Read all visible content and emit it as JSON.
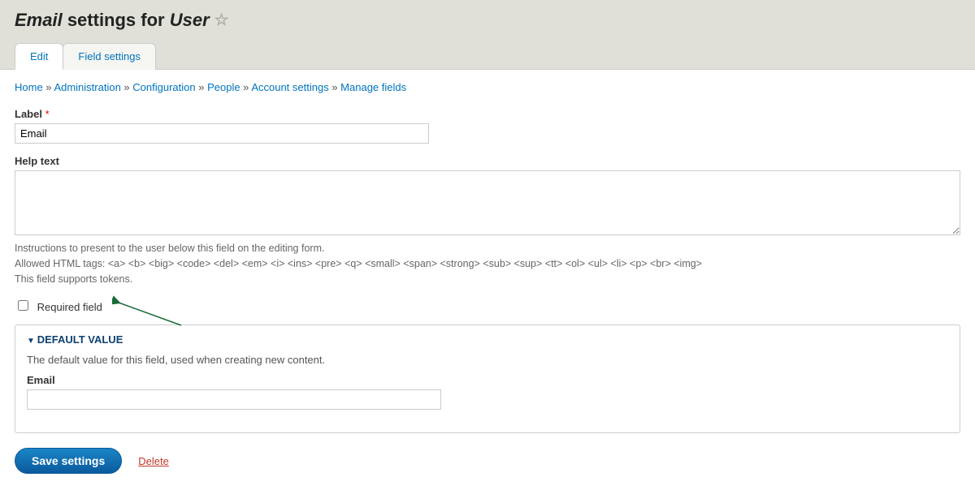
{
  "page": {
    "title_prefix": "Email",
    "title_mid": " settings for ",
    "title_suffix": "User"
  },
  "tabs": [
    {
      "label": "Edit",
      "active": true
    },
    {
      "label": "Field settings",
      "active": false
    }
  ],
  "breadcrumb": {
    "items": [
      "Home",
      "Administration",
      "Configuration",
      "People",
      "Account settings",
      "Manage fields"
    ],
    "sep": " » "
  },
  "form": {
    "label_field": {
      "label": "Label",
      "required_mark": "*",
      "value": "Email"
    },
    "help_text": {
      "label": "Help text",
      "value": "",
      "desc_line1": "Instructions to present to the user below this field on the editing form.",
      "desc_line2": "Allowed HTML tags: <a> <b> <big> <code> <del> <em> <i> <ins> <pre> <q> <small> <span> <strong> <sub> <sup> <tt> <ol> <ul> <li> <p> <br> <img>",
      "desc_line3": "This field supports tokens."
    },
    "required_checkbox": {
      "label": "Required field",
      "checked": false
    },
    "default_value": {
      "legend": "Default value",
      "desc": "The default value for this field, used when creating new content.",
      "field_label": "Email",
      "field_value": ""
    }
  },
  "actions": {
    "save": "Save settings",
    "delete": "Delete"
  }
}
